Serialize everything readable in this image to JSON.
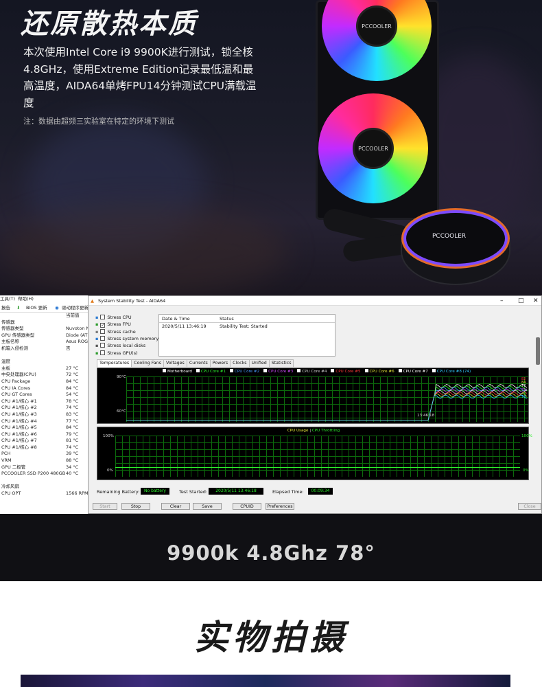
{
  "hero": {
    "title": "还原散热本质",
    "paragraph": "本次使用Intel Core i9 9900K进行测试，锁全核4.8GHz，使用Extreme Edition记录最低温和最高温度，AIDA64单烤FPU14分钟测试CPU满载温度",
    "note": "注：数据由超频三实验室在特定的环境下测试",
    "brand": "PCCOOLER"
  },
  "hwinfo": {
    "menu": [
      "工具(T)",
      "帮助(H)"
    ],
    "toolbar": [
      "报告",
      "BIOS 更新",
      "驱动程序更新"
    ],
    "current_value_header": "当前值",
    "sensor_props_header": "传感器",
    "rows": [
      {
        "name": "传感器类型",
        "value": "Nuvoton N"
      },
      {
        "name": "GPU 传感器类型",
        "value": "Diode (ATI"
      },
      {
        "name": "主板名称",
        "value": "Asus ROG"
      },
      {
        "name": "机箱入侵检测",
        "value": "否"
      }
    ],
    "temp_header": "温度",
    "temps": [
      {
        "name": "主板",
        "value": "27 °C"
      },
      {
        "name": "中央处理器(CPU)",
        "value": "72 °C"
      },
      {
        "name": "CPU Package",
        "value": "84 °C"
      },
      {
        "name": "CPU IA Cores",
        "value": "84 °C"
      },
      {
        "name": "CPU GT Cores",
        "value": "54 °C"
      },
      {
        "name": "CPU #1/核心 #1",
        "value": "78 °C"
      },
      {
        "name": "CPU #1/核心 #2",
        "value": "74 °C"
      },
      {
        "name": "CPU #1/核心 #3",
        "value": "83 °C"
      },
      {
        "name": "CPU #1/核心 #4",
        "value": "77 °C"
      },
      {
        "name": "CPU #1/核心 #5",
        "value": "84 °C"
      },
      {
        "name": "CPU #1/核心 #6",
        "value": "79 °C"
      },
      {
        "name": "CPU #1/核心 #7",
        "value": "81 °C"
      },
      {
        "name": "CPU #1/核心 #8",
        "value": "74 °C"
      },
      {
        "name": "PCH",
        "value": "39 °C"
      },
      {
        "name": "VRM",
        "value": "88 °C"
      },
      {
        "name": "GPU 二极管",
        "value": "34 °C"
      },
      {
        "name": "PCCOOLER SSD P200 480GB",
        "value": "40 °C"
      }
    ],
    "fan_header": "冷却风扇",
    "fans": [
      {
        "name": "CPU OPT",
        "value": "1566 RPM"
      }
    ]
  },
  "aida": {
    "title": "System Stability Test - AIDA64",
    "stress": [
      {
        "label": "Stress CPU",
        "checked": false
      },
      {
        "label": "Stress FPU",
        "checked": true
      },
      {
        "label": "Stress cache",
        "checked": false
      },
      {
        "label": "Stress system memory",
        "checked": false
      },
      {
        "label": "Stress local disks",
        "checked": false
      },
      {
        "label": "Stress GPU(s)",
        "checked": false
      }
    ],
    "table_headers": [
      "Date & Time",
      "Status"
    ],
    "table_row": [
      "2020/5/11 13:46:19",
      "Stability Test: Started"
    ],
    "tabs": [
      "Temperatures",
      "Cooling Fans",
      "Voltages",
      "Currents",
      "Powers",
      "Clocks",
      "Unified",
      "Statistics"
    ],
    "legend": [
      {
        "label": "Motherboard",
        "color": "#ffffff"
      },
      {
        "label": "CPU Core #1",
        "color": "#2df02d"
      },
      {
        "label": "CPU Core #2",
        "color": "#4a9cff"
      },
      {
        "label": "CPU Core #3",
        "color": "#d14dff"
      },
      {
        "label": "CPU Core #4",
        "color": "#cfcfcf"
      },
      {
        "label": "CPU Core #5",
        "color": "#ff3a3a"
      },
      {
        "label": "CPU Core #6",
        "color": "#e8e83a"
      },
      {
        "label": "CPU Core #7",
        "color": "#ffffff"
      },
      {
        "label": "CPU Core #8 (74)",
        "color": "#33c9ff"
      }
    ],
    "temp_top": "90°C",
    "temp_bottom": "60°C",
    "time_label": "13:46:18",
    "right_values": [
      "82",
      "84",
      "77",
      "79",
      "74",
      "74"
    ],
    "usage_title_a": "CPU Usage",
    "usage_sep": "|",
    "usage_title_b": "CPU Throttling",
    "usage_top": "100%",
    "usage_bottom": "0%",
    "usage_top_right": "100%",
    "usage_bottom_right": "0%",
    "remaining_label": "Remaining Battery:",
    "remaining_value": "No battery",
    "started_label": "Test Started:",
    "started_value": "2020/5/11 13:46:18",
    "elapsed_label": "Elapsed Time:",
    "elapsed_value": "00:09:34",
    "buttons": [
      "Start",
      "Stop",
      "Clear",
      "Save",
      "CPUID",
      "Preferences",
      "Close"
    ]
  },
  "caption": "9900k 4.8Ghz 78°",
  "section_title": "实物拍摄"
}
